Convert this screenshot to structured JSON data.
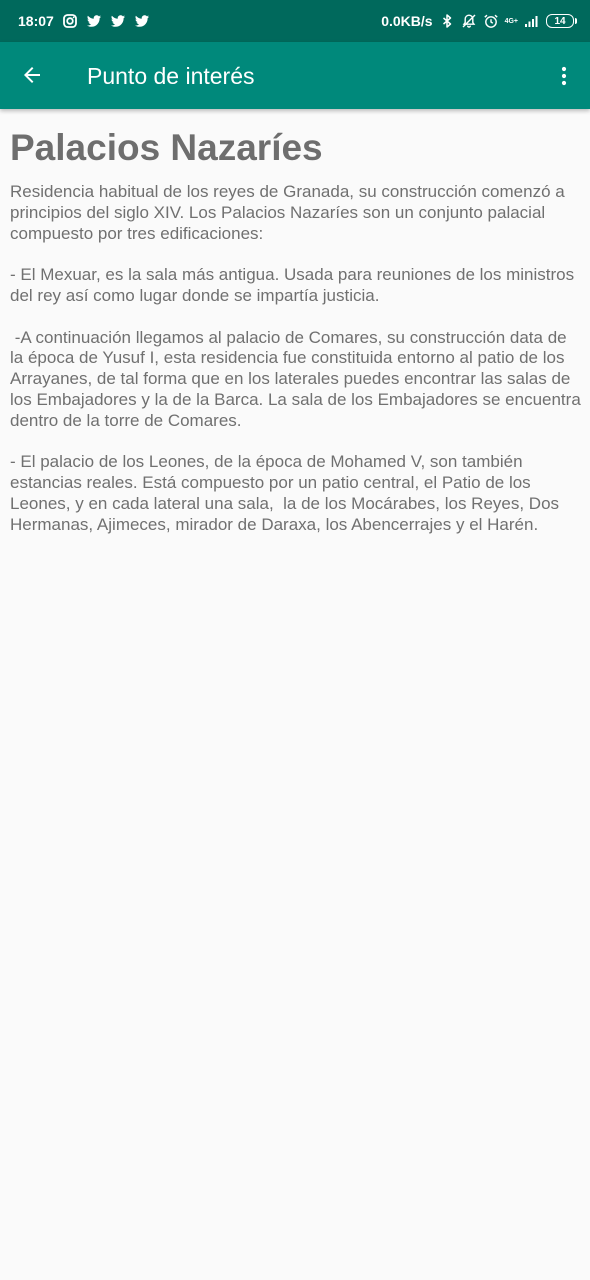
{
  "status_bar": {
    "time": "18:07",
    "notification_icons": [
      "instagram-icon",
      "twitter-icon",
      "twitter-icon",
      "twitter-icon"
    ],
    "network_speed": "0.0KB/s",
    "network_type": "4G+",
    "battery_level": "14"
  },
  "app_bar": {
    "title": "Punto de interés",
    "back_icon": "arrow-back-icon",
    "menu_icon": "more-vert-icon",
    "color": "#00897b"
  },
  "poi": {
    "title": "Palacios Nazaríes",
    "description": "Residencia habitual de los reyes de Granada, su construcción comenzó a principios del siglo XIV. Los Palacios Nazaríes son un conjunto palacial compuesto por tres edificaciones:\n\n- El Mexuar, es la sala más antigua. Usada para reuniones de los ministros del rey así como lugar donde se impartía justicia.\n\n -A continuación llegamos al palacio de Comares, su construcción data de la época de Yusuf I, esta residencia fue constituida entorno al patio de los Arrayanes, de tal forma que en los laterales puedes encontrar las salas de los Embajadores y la de la Barca. La sala de los Embajadores se encuentra dentro de la torre de Comares.\n\n- El palacio de los Leones, de la época de Mohamed V, son también estancias reales. Está compuesto por un patio central, el Patio de los Leones, y en cada lateral una sala,  la de los Mocárabes, los Reyes, Dos Hermanas, Ajimeces, mirador de Daraxa, los Abencerrajes y el Harén."
  }
}
